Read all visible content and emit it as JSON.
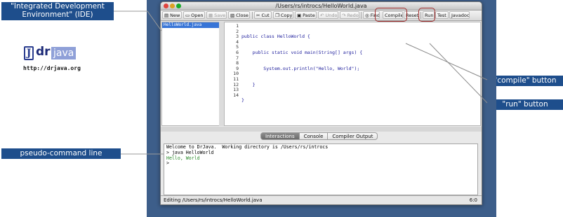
{
  "callouts": {
    "ide": "\"Integrated Development\nEnvironment\" (IDE)",
    "compile": "\"compile\" button",
    "run": "\"run\" button",
    "pseudo": "pseudo-command line"
  },
  "logo": {
    "j": "J",
    "dr": "dr",
    "java": "java",
    "url": "http://drjava.org"
  },
  "window": {
    "title": "/Users/rs/introcs/HelloWorld.java"
  },
  "toolbar": {
    "new": "New",
    "open": "Open",
    "save": "Save",
    "close": "Close",
    "cut": "Cut",
    "copy": "Copy",
    "paste": "Paste",
    "undo": "Undo",
    "redo": "Redo",
    "find": "Find",
    "compile": "Compile",
    "reset": "Reset",
    "run": "Run",
    "test": "Test",
    "javadoc": "Javadoc"
  },
  "files": [
    "HelloWorld.java"
  ],
  "editor": {
    "line_numbers": [
      "1",
      "2",
      "3",
      "4",
      "5",
      "6",
      "7",
      "8",
      "9",
      "10",
      "11",
      "12",
      "13",
      "14"
    ],
    "code": [
      "public class HelloWorld {",
      "    public static void main(String[] args) {",
      "        System.out.println(\"Hello, World\");",
      "    }",
      "}"
    ]
  },
  "tabs": [
    "Interactions",
    "Console",
    "Compiler Output"
  ],
  "console": {
    "welcome": "Welcome to DrJava.  Working directory is /Users/rs/introcs",
    "command": "> java HelloWorld",
    "output": "Hello, World",
    "prompt": ">"
  },
  "status": {
    "left": "Editing /Users/rs/introcs/HelloWorld.java",
    "right": "6:0"
  },
  "colors": {
    "callout_bg": "#1e4e8c",
    "desktop": "#3d5e8a",
    "highlight": "#a32c2c",
    "selection": "#3875d7",
    "output_green": "#2a8a2a"
  }
}
